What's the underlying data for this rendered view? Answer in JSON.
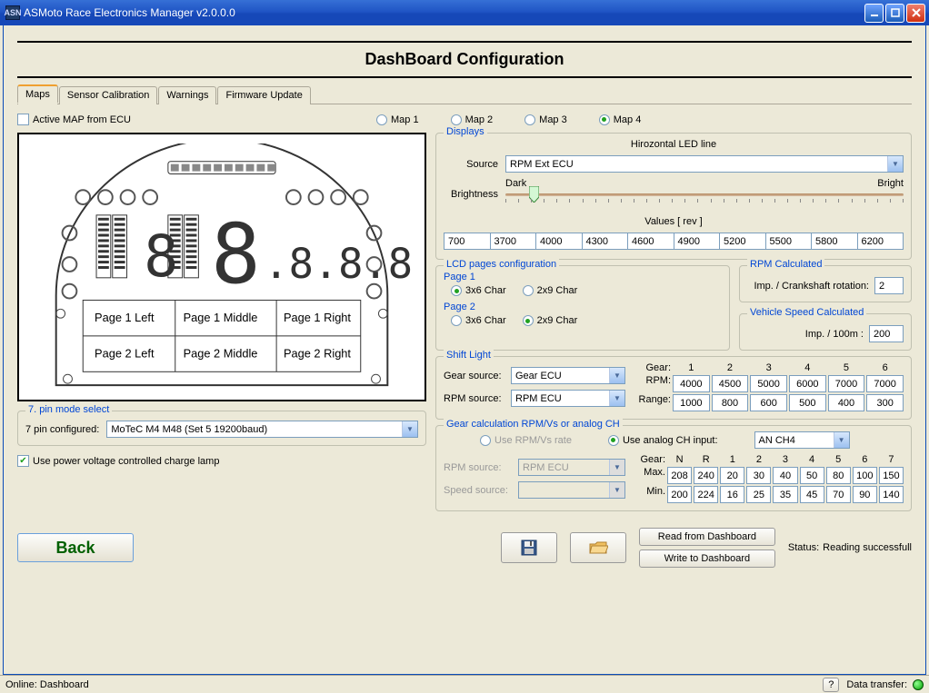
{
  "window_title": "ASMoto Race Electronics Manager v2.0.0.0",
  "page_title": "DashBoard Configuration",
  "tabs": {
    "maps": "Maps",
    "sensor": "Sensor Calibration",
    "warnings": "Warnings",
    "firmware": "Firmware Update"
  },
  "active_map_label": "Active MAP from ECU",
  "map_labels": {
    "m1": "Map 1",
    "m2": "Map 2",
    "m3": "Map 3",
    "m4": "Map 4"
  },
  "dash_pages": {
    "p1l": "Page 1 Left",
    "p1m": "Page 1 Middle",
    "p1r": "Page 1 Right",
    "p2l": "Page 2 Left",
    "p2m": "Page 2 Middle",
    "p2r": "Page 2 Right"
  },
  "pin_mode": {
    "legend": "7. pin mode select",
    "label": "7 pin configured:",
    "value": "MoTeC M4 M48 (Set 5 19200baud)"
  },
  "charge_lamp_label": "Use power voltage controlled charge lamp",
  "displays": {
    "legend": "Displays",
    "title": "Hirozontal LED line",
    "source_label": "Source",
    "source_value": "RPM Ext ECU",
    "dark": "Dark",
    "bright": "Bright",
    "brightness": "Brightness",
    "values_label": "Values [ rev ]",
    "values": [
      "700",
      "3700",
      "4000",
      "4300",
      "4600",
      "4900",
      "5200",
      "5500",
      "5800",
      "6200"
    ]
  },
  "lcd": {
    "legend": "LCD pages configuration",
    "page1": "Page 1",
    "page2": "Page 2",
    "opt1": "3x6 Char",
    "opt2": "2x9 Char"
  },
  "rpm_calc": {
    "legend": "RPM Calculated",
    "label": "Imp. / Crankshaft rotation:",
    "value": "2"
  },
  "speed_calc": {
    "legend": "Vehicle Speed Calculated",
    "label": "Imp. / 100m :",
    "value": "200"
  },
  "shift": {
    "legend": "Shift Light",
    "gear_src_label": "Gear source:",
    "gear_src": "Gear ECU",
    "rpm_src_label": "RPM source:",
    "rpm_src": "RPM ECU",
    "gear": "Gear:",
    "rpm": "RPM:",
    "range": "Range:",
    "gears": [
      "1",
      "2",
      "3",
      "4",
      "5",
      "6"
    ],
    "rpms": [
      "4000",
      "4500",
      "5000",
      "6000",
      "7000",
      "7000"
    ],
    "ranges": [
      "1000",
      "800",
      "600",
      "500",
      "400",
      "300"
    ]
  },
  "gearcalc": {
    "legend": "Gear calculation RPM/Vs or analog CH",
    "opt1": "Use RPM/Vs rate",
    "opt2": "Use analog CH input:",
    "ch": "AN CH4",
    "rpm_src_label": "RPM source:",
    "rpm_src": "RPM ECU",
    "speed_src_label": "Speed source:",
    "speed_src": "",
    "gear": "Gear:",
    "max": "Max.",
    "min": "Min.",
    "headers": [
      "N",
      "R",
      "1",
      "2",
      "3",
      "4",
      "5",
      "6",
      "7"
    ],
    "maxv": [
      "208",
      "240",
      "20",
      "30",
      "40",
      "50",
      "80",
      "100",
      "150"
    ],
    "minv": [
      "200",
      "224",
      "16",
      "25",
      "35",
      "45",
      "70",
      "90",
      "140"
    ]
  },
  "buttons": {
    "back": "Back",
    "read": "Read from Dashboard",
    "write": "Write to Dashboard"
  },
  "status_label": "Status:",
  "status_text": "Reading successfull",
  "statusbar_left": "Online: Dashboard",
  "statusbar_right": "Data transfer:"
}
